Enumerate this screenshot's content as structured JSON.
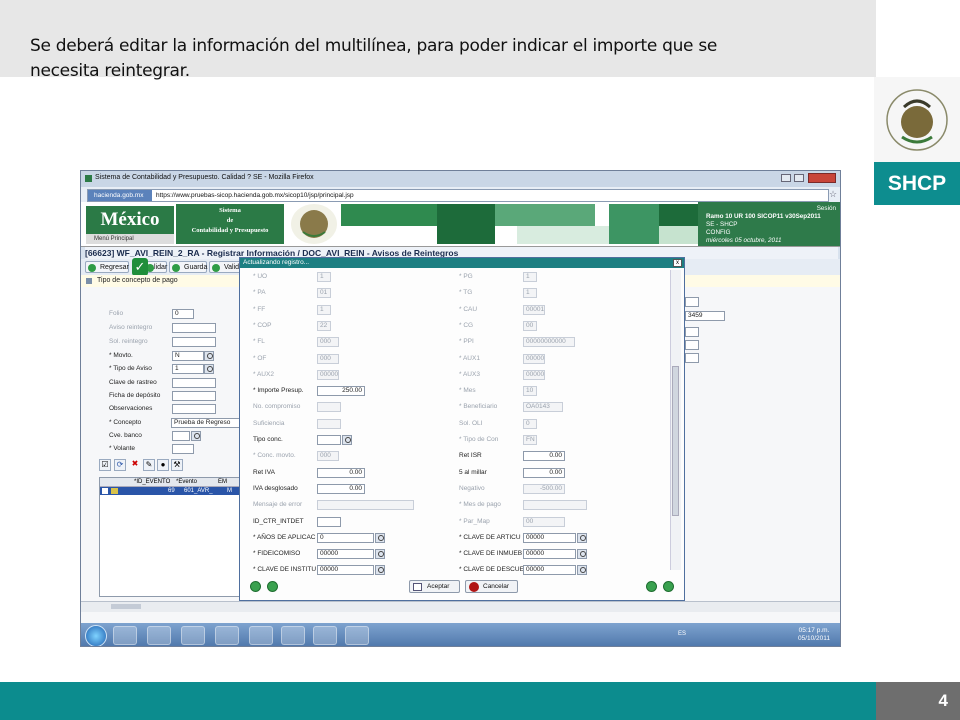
{
  "slide": {
    "caption_line1": "Se deberá  editar  la  información del  multilínea, para  poder  indicar  el  importe  que se",
    "caption_line2": "necesita  reintegrar.",
    "brand": "SHCP",
    "page_number": "4",
    "colors": {
      "teal": "#0c8c8e",
      "gray_band": "#e7e7e7",
      "page_box": "#6e6e6e"
    }
  },
  "browser": {
    "window_title": "Sistema de Contabilidad y Presupuesto. Calidad ? SE - Mozilla Firefox",
    "host_chip": "hacienda.gob.mx",
    "url": "https://www.pruebas-sicop.hacienda.gob.mx/sicop10/jsp/principal.jsp"
  },
  "app": {
    "logo_text": "México",
    "menu_principal": "Menú Principal",
    "system_name_line1": "Sistema",
    "system_name_line2": "de",
    "system_name_line3": "Contabilidad y Presupuesto",
    "session": {
      "label": "Sesión",
      "line1": "Ramo 10 UR 100 SICOP11 v30Sep2011",
      "line2": "SE - SHCP",
      "line3": "CONFIG",
      "line4": "miércoles 05 octubre, 2011"
    },
    "page_title": "[66623] WF_AVI_REIN_2_RA - Registrar Información / DOC_AVI_REIN - Avisos de Reintegros",
    "toolbar": {
      "regresar": "Regresar",
      "validar": "Validar",
      "guarda": "Guarda",
      "valida": "Valida"
    },
    "tipo_concepto": "Tipo de concepto de pago",
    "form_left": [
      {
        "label": "Folio",
        "value": "0"
      },
      {
        "label": "Aviso reintegro",
        "value": ""
      },
      {
        "label": "Sol. reintegro",
        "value": ""
      },
      {
        "label": "* Movto.",
        "value": "N"
      },
      {
        "label": "* Tipo de Aviso",
        "value": "1"
      },
      {
        "label": "Clave de rastreo",
        "value": ""
      },
      {
        "label": "Ficha de depósito",
        "value": ""
      },
      {
        "label": "Observaciones",
        "value": ""
      },
      {
        "label": "* Concepto",
        "value": "Prueba de Regreso"
      },
      {
        "label": "Cve. banco",
        "value": ""
      },
      {
        "label": "* Volante",
        "value": ""
      }
    ],
    "right_partial_value": "3459",
    "grid": {
      "headers": [
        "*ID_EVENTO",
        "*Evento",
        "EM"
      ],
      "row": [
        "69",
        "601_AVR_",
        "M"
      ]
    }
  },
  "dialog": {
    "title": "Actualizando registro...",
    "close": "x",
    "left_fields": [
      {
        "label": "* UO",
        "value": "1",
        "dim": true
      },
      {
        "label": "* PA",
        "value": "01",
        "dim": true
      },
      {
        "label": "* FF",
        "value": "1",
        "dim": true
      },
      {
        "label": "* COP",
        "value": "22",
        "dim": true
      },
      {
        "label": "* FL",
        "value": "000",
        "dim": true
      },
      {
        "label": "* OF",
        "value": "000",
        "dim": true
      },
      {
        "label": "* AUX2",
        "value": "00000",
        "dim": true
      },
      {
        "label": "* Importe Presup.",
        "value": "250.00",
        "dim": false
      },
      {
        "label": "No. compromiso",
        "value": "",
        "dim": true
      },
      {
        "label": "Suficiencia",
        "value": "",
        "dim": true
      },
      {
        "label": "Tipo conc.",
        "value": "",
        "dim": false
      },
      {
        "label": "* Conc. movto.",
        "value": "000",
        "dim": true
      },
      {
        "label": "Ret IVA",
        "value": "0.00",
        "dim": false
      },
      {
        "label": "IVA desglosado",
        "value": "0.00",
        "dim": false
      },
      {
        "label": "Mensaje de error",
        "value": "",
        "dim": true
      },
      {
        "label": "ID_CTR_INTDET",
        "value": "",
        "dim": false
      },
      {
        "label": "* AÑOS DE APLICAC",
        "value": "0",
        "dim": false
      },
      {
        "label": "* FIDEICOMISO",
        "value": "00000",
        "dim": false
      },
      {
        "label": "* CLAVE DE INSTITU",
        "value": "00000",
        "dim": false
      }
    ],
    "right_fields": [
      {
        "label": "* PG",
        "value": "1",
        "dim": true
      },
      {
        "label": "* TG",
        "value": "1",
        "dim": true
      },
      {
        "label": "* CAU",
        "value": "00001",
        "dim": true
      },
      {
        "label": "* CG",
        "value": "00",
        "dim": true
      },
      {
        "label": "* PPI",
        "value": "00000000000",
        "dim": true
      },
      {
        "label": "* AUX1",
        "value": "00000",
        "dim": true
      },
      {
        "label": "* AUX3",
        "value": "00000",
        "dim": true
      },
      {
        "label": "* Mes",
        "value": "10",
        "dim": true
      },
      {
        "label": "* Beneficiario",
        "value": "OA0143",
        "dim": true
      },
      {
        "label": "Sol. OLI",
        "value": "0",
        "dim": true
      },
      {
        "label": "* Tipo de Con",
        "value": "FN",
        "dim": true
      },
      {
        "label": "Ret ISR",
        "value": "0.00",
        "dim": false
      },
      {
        "label": "5 al millar",
        "value": "0.00",
        "dim": false
      },
      {
        "label": "Negativo",
        "value": "-500.00",
        "dim": true
      },
      {
        "label": "* Mes de pago",
        "value": "",
        "dim": true
      },
      {
        "label": "* Par_Map",
        "value": "00",
        "dim": true
      },
      {
        "label": "* CLAVE DE ARTICU",
        "value": "00000",
        "dim": false
      },
      {
        "label": "* CLAVE DE INMUEB",
        "value": "00000",
        "dim": false
      },
      {
        "label": "* CLAVE DE DESCUE",
        "value": "00000",
        "dim": false
      }
    ],
    "aceptar": "Aceptar",
    "cancelar": "Cancelar"
  },
  "taskbar": {
    "lang": "ES",
    "time": "05:17 p.m.",
    "date": "05/10/2011"
  }
}
